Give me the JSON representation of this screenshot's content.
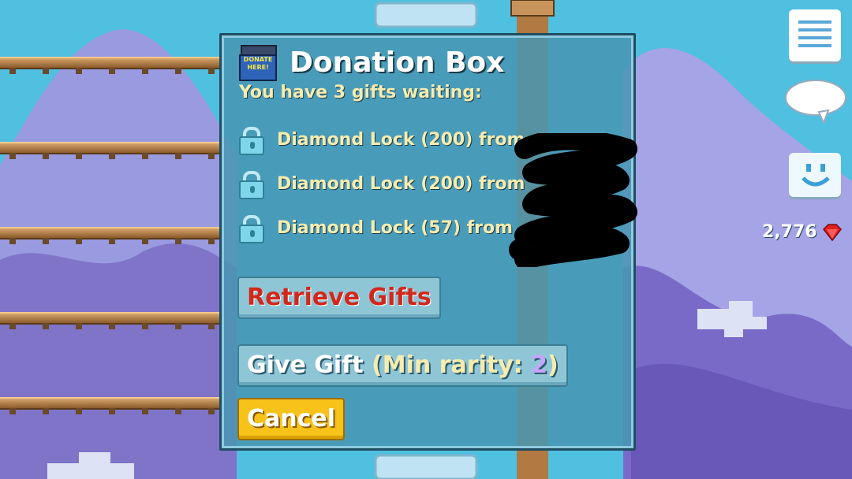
{
  "dialog": {
    "icon_text": "DONATE HERE!",
    "title": "Donation Box",
    "subtitle": "You have 3 gifts waiting:",
    "gifts": [
      {
        "text": "Diamond Lock (200) from"
      },
      {
        "text": "Diamond Lock (200) from"
      },
      {
        "text": "Diamond Lock (57) from"
      }
    ],
    "retrieve_label": "Retrieve Gifts",
    "give_label": "Give Gift",
    "give_paren_open": "(Min rarity: ",
    "give_rarity": "2",
    "give_paren_close": ")",
    "cancel_label": "Cancel"
  },
  "hud": {
    "gems": "2,776"
  },
  "colors": {
    "sky": "#4fc0e0",
    "mountains": "#8f8fd8",
    "dialog_bg": "#4896b2",
    "retrieve_text": "#d2271c",
    "cancel_bg": "#f7c21a",
    "gem": "#e02020"
  },
  "icons": [
    "donate-box-icon",
    "diamond-lock-icon",
    "menu-list-icon",
    "chat-bubble-icon",
    "smiley-face-icon",
    "gem-icon"
  ]
}
